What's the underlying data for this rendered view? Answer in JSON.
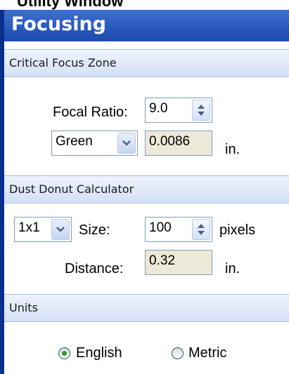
{
  "window_title": "Utility Window",
  "panel": {
    "title": "Focusing",
    "sections": {
      "critical_focus": {
        "title": "Critical Focus Zone",
        "focal_ratio_label": "Focal Ratio:",
        "focal_ratio_value": "9.0",
        "color_selected": "Green",
        "zone_value": "0.0086",
        "zone_unit": "in."
      },
      "dust_donut": {
        "title": "Dust Donut Calculator",
        "binning_selected": "1x1",
        "size_label": "Size:",
        "size_value": "100",
        "size_unit": "pixels",
        "distance_label": "Distance:",
        "distance_value": "0.32",
        "distance_unit": "in."
      },
      "units": {
        "title": "Units",
        "options": [
          {
            "label": "English",
            "selected": true
          },
          {
            "label": "Metric",
            "selected": false
          }
        ]
      }
    }
  },
  "colors": {
    "header_blue": "#1c49ad",
    "section_bg": "#d3e0f6",
    "readonly_bg": "#ece9d8",
    "border_blue": "#0b2f8c"
  },
  "icons": [
    "spin-up-down-icon",
    "chevron-down-icon",
    "radio-selected-icon",
    "radio-unselected-icon"
  ]
}
